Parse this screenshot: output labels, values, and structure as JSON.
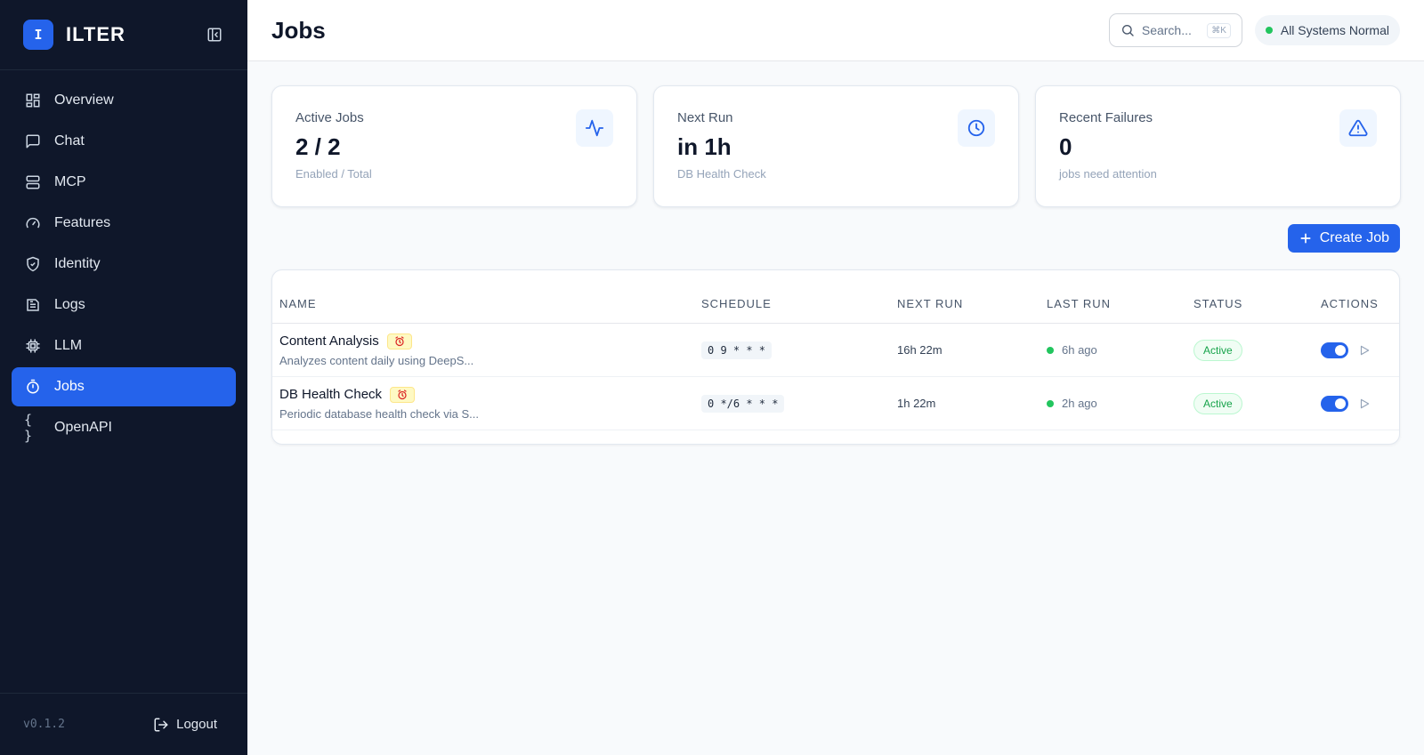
{
  "brand": {
    "logo_letter": "I",
    "name": "ILTER"
  },
  "nav": {
    "items": [
      {
        "label": "Overview",
        "icon": "grid-icon"
      },
      {
        "label": "Chat",
        "icon": "chat-icon"
      },
      {
        "label": "MCP",
        "icon": "server-icon"
      },
      {
        "label": "Features",
        "icon": "gauge-icon"
      },
      {
        "label": "Identity",
        "icon": "shield-icon"
      },
      {
        "label": "Logs",
        "icon": "logs-icon"
      },
      {
        "label": "LLM",
        "icon": "chip-icon"
      },
      {
        "label": "Jobs",
        "icon": "stopwatch-icon",
        "active": true
      },
      {
        "label": "OpenAPI",
        "icon": "braces-icon"
      }
    ],
    "braces_glyph": "{ }"
  },
  "footer": {
    "version": "v0.1.2",
    "logout_label": "Logout"
  },
  "header": {
    "title": "Jobs",
    "search_placeholder": "Search...",
    "search_shortcut": "⌘K",
    "system_status": "All Systems Normal"
  },
  "stats": [
    {
      "label": "Active Jobs",
      "value": "2 / 2",
      "sub": "Enabled / Total",
      "icon": "activity-icon"
    },
    {
      "label": "Next Run",
      "value": "in 1h",
      "sub": "DB Health Check",
      "icon": "clock-icon"
    },
    {
      "label": "Recent Failures",
      "value": "0",
      "sub": "jobs need attention",
      "icon": "alert-triangle-icon"
    }
  ],
  "create_job_label": "Create Job",
  "table": {
    "headers": [
      "NAME",
      "SCHEDULE",
      "NEXT RUN",
      "LAST RUN",
      "STATUS",
      "ACTIONS"
    ],
    "rows": [
      {
        "name": "Content Analysis",
        "desc": "Analyzes content daily using DeepS...",
        "schedule": "0 9 * * *",
        "next_run": "16h 22m",
        "last_run": "6h ago",
        "status": "Active",
        "enabled": true
      },
      {
        "name": "DB Health Check",
        "desc": "Periodic database health check via S...",
        "schedule": "0 */6 * * *",
        "next_run": "1h 22m",
        "last_run": "2h ago",
        "status": "Active",
        "enabled": true
      }
    ]
  },
  "colors": {
    "sidebar_bg": "#0f172a",
    "accent": "#2563eb",
    "success": "#22c55e"
  }
}
